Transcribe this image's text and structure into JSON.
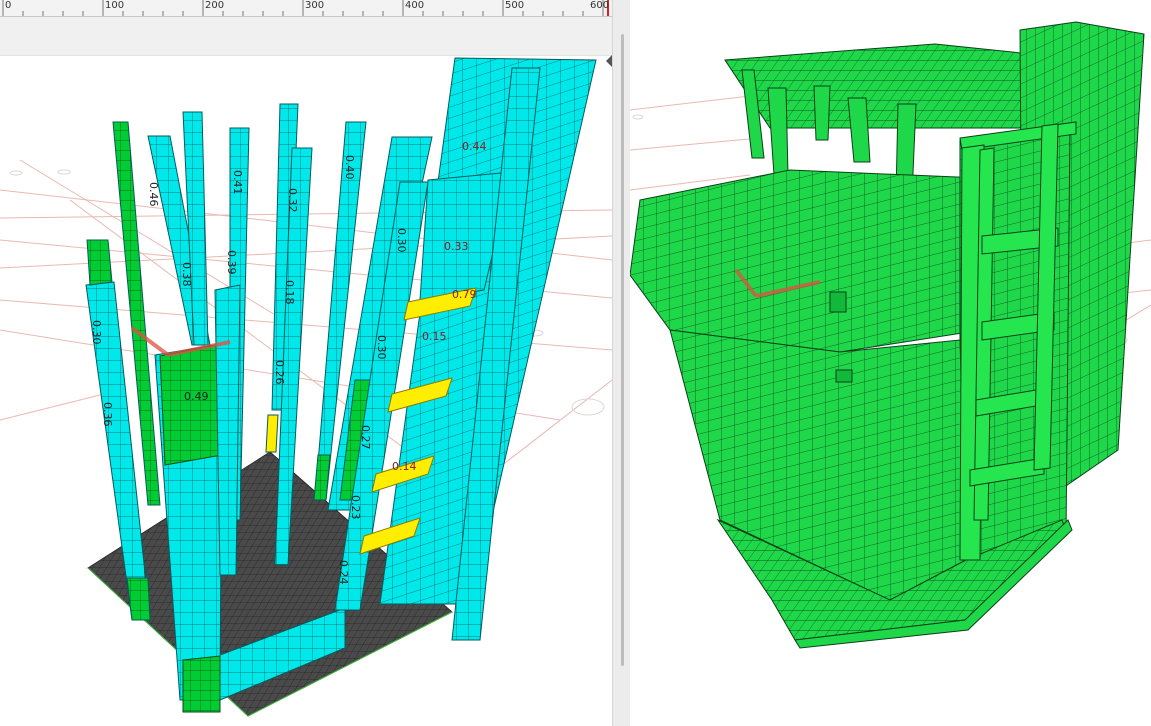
{
  "ruler": {
    "ticks": [
      "0",
      "100",
      "200",
      "300",
      "400",
      "500",
      "600"
    ]
  },
  "left_model": {
    "labels": [
      "0.46",
      "0.38",
      "0.41",
      "0.32",
      "0.30",
      "0.30",
      "0.27",
      "0.23",
      "0.24",
      "0.30",
      "0.39",
      "0.44",
      "0.79",
      "0.18",
      "0.49",
      "0.33",
      "0.40",
      "0.26",
      "0.36",
      "0.15",
      "0.14"
    ]
  },
  "colors": {
    "element_cyan": "#00e8ea",
    "element_green": "#00cc33",
    "beam_yellow": "#ffee00",
    "mesh_grey": "#4a4a4a",
    "right_model_green": "#1fd84a",
    "axis_red": "#e05040"
  }
}
